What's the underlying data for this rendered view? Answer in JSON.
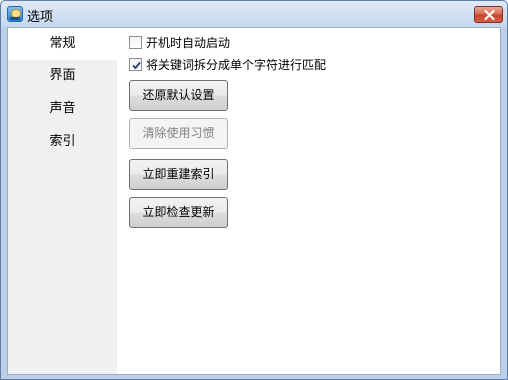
{
  "window": {
    "title": "选项",
    "icon": "app-icon"
  },
  "sidebar": {
    "items": [
      {
        "label": "常规",
        "selected": true
      },
      {
        "label": "界面",
        "selected": false
      },
      {
        "label": "声音",
        "selected": false
      },
      {
        "label": "索引",
        "selected": false
      }
    ]
  },
  "general": {
    "checkboxes": [
      {
        "label": "开机时自动启动",
        "checked": false
      },
      {
        "label": "将关键词拆分成单个字符进行匹配",
        "checked": true
      }
    ],
    "buttons": [
      {
        "label": "还原默认设置",
        "enabled": true
      },
      {
        "label": "清除使用习惯",
        "enabled": false
      },
      {
        "label": "立即重建索引",
        "enabled": true
      },
      {
        "label": "立即检查更新",
        "enabled": true
      }
    ]
  },
  "colors": {
    "close_button": "#c4432b",
    "sidebar_bg": "#f0f0f0",
    "frame": "#bcd0ea"
  }
}
